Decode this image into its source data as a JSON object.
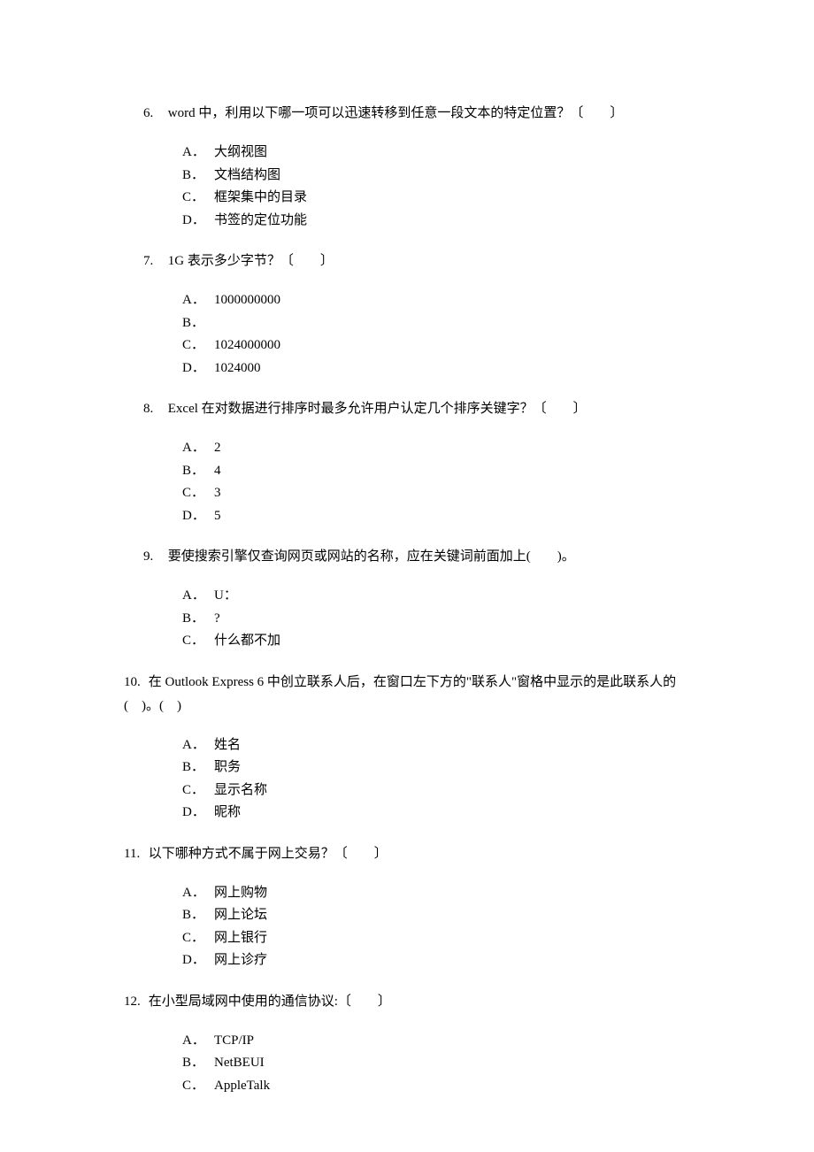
{
  "questions": [
    {
      "num": "6.",
      "text": "word 中，利用以下哪一项可以迅速转移到任意一段文本的特定位置？〔　　〕",
      "indent": true,
      "options": [
        {
          "label": "A．",
          "text": "大纲视图"
        },
        {
          "label": "B．",
          "text": "文档结构图"
        },
        {
          "label": "C．",
          "text": "框架集中的目录"
        },
        {
          "label": "D．",
          "text": "书签的定位功能"
        }
      ]
    },
    {
      "num": "7.",
      "text": "1G 表示多少字节？〔　　〕",
      "indent": true,
      "options": [
        {
          "label": "A．",
          "text": "1000000000"
        },
        {
          "label": "B．",
          "text": ""
        },
        {
          "label": "C．",
          "text": "1024000000"
        },
        {
          "label": "D．",
          "text": "1024000"
        }
      ]
    },
    {
      "num": "8.",
      "text": "Excel 在对数据进行排序时最多允许用户认定几个排序关键字？〔　　〕",
      "indent": true,
      "options": [
        {
          "label": "A．",
          "text": "2"
        },
        {
          "label": "B．",
          "text": "4"
        },
        {
          "label": "C．",
          "text": "3"
        },
        {
          "label": "D．",
          "text": "5"
        }
      ]
    },
    {
      "num": "9.",
      "text": "要使搜索引擎仅查询网页或网站的名称，应在关键词前面加上(　　)。",
      "indent": true,
      "options": [
        {
          "label": "A．",
          "text": "U："
        },
        {
          "label": "B．",
          "text": "?"
        },
        {
          "label": "C．",
          "text": "什么都不加"
        }
      ]
    },
    {
      "num": "10.",
      "text": "在 Outlook Express 6 中创立联系人后，在窗口左下方的\"联系人\"窗格中显示的是此联系人的(　)。(　)",
      "indent": false,
      "options": [
        {
          "label": "A．",
          "text": "姓名"
        },
        {
          "label": "B．",
          "text": "职务"
        },
        {
          "label": "C．",
          "text": "显示名称"
        },
        {
          "label": "D．",
          "text": "昵称"
        }
      ]
    },
    {
      "num": "11.",
      "text": "以下哪种方式不属于网上交易？〔　　〕",
      "indent": false,
      "options": [
        {
          "label": "A．",
          "text": "网上购物"
        },
        {
          "label": "B．",
          "text": "网上论坛"
        },
        {
          "label": "C．",
          "text": "网上银行"
        },
        {
          "label": "D．",
          "text": "网上诊疗"
        }
      ]
    },
    {
      "num": "12.",
      "text": "在小型局域网中使用的通信协议:〔　　〕",
      "indent": false,
      "options": [
        {
          "label": "A．",
          "text": "TCP/IP"
        },
        {
          "label": "B．",
          "text": "NetBEUI"
        },
        {
          "label": "C．",
          "text": "AppleTalk"
        }
      ]
    }
  ]
}
